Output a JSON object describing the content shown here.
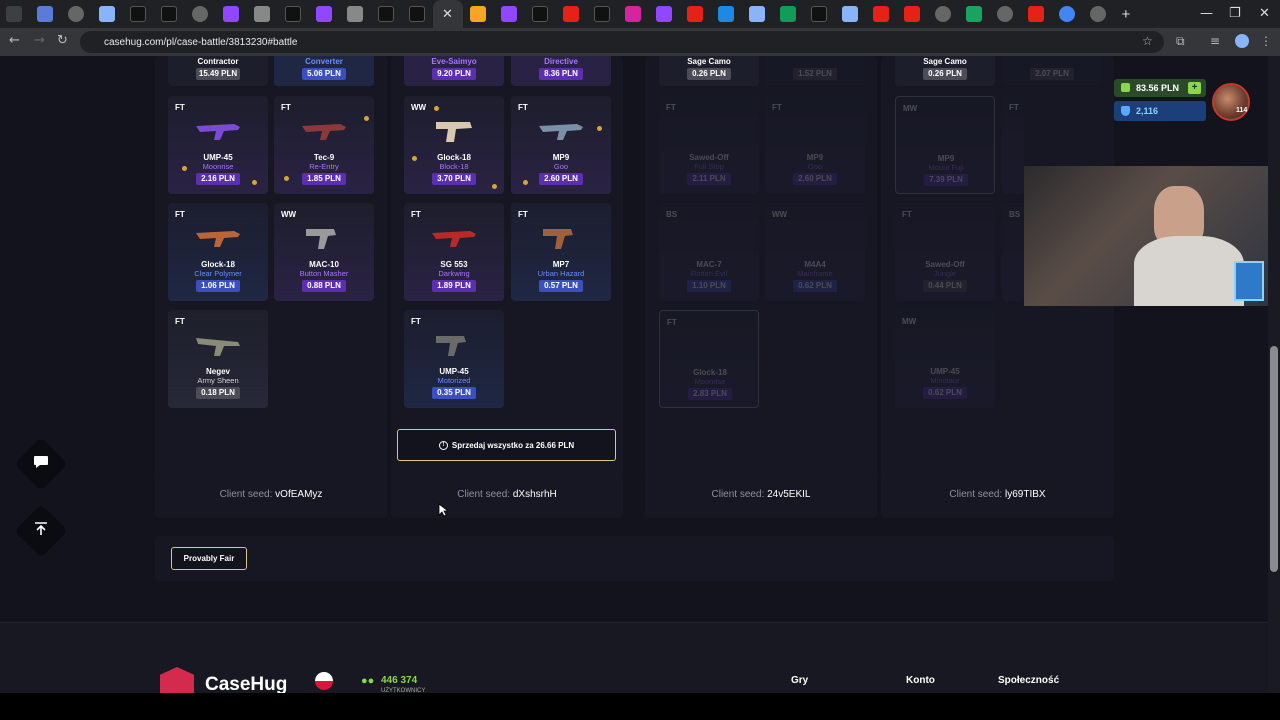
{
  "browser": {
    "url": "casehug.com/pl/case-battle/3813230#battle",
    "active_tab_close": "✕",
    "new_tab": "+",
    "minimize": "—",
    "restore": "❐",
    "close": "✕"
  },
  "nav": {
    "back_icon": "←",
    "forward_icon": "→",
    "reload_icon": "↻"
  },
  "top_row": {
    "col1": [
      {
        "name": "Contractor",
        "price": "15.49 PLN"
      },
      {
        "name": "Converter",
        "price": "5.06 PLN"
      }
    ],
    "col2": [
      {
        "name": "Eve-Saimyo",
        "price": "9.20 PLN"
      },
      {
        "name": "Directive",
        "price": "8.36 PLN"
      }
    ],
    "col3": [
      {
        "name": "Sage Camo",
        "price": "0.26 PLN"
      },
      {
        "name": "",
        "price": "1.52 PLN"
      }
    ],
    "col4": [
      {
        "name": "Sage Camo",
        "price": "0.26 PLN"
      },
      {
        "name": "",
        "price": "2.07 PLN"
      }
    ]
  },
  "columns": [
    {
      "cards": [
        {
          "wear": "FT",
          "name": "UMP-45",
          "skin": "Moonrise",
          "price": "2.16 PLN"
        },
        {
          "wear": "FT",
          "name": "Tec-9",
          "skin": "Re-Entry",
          "price": "1.85 PLN"
        },
        {
          "wear": "FT",
          "name": "Glock-18",
          "skin": "Clear Polymer",
          "price": "1.06 PLN"
        },
        {
          "wear": "WW",
          "name": "MAC-10",
          "skin": "Button Masher",
          "price": "0.88 PLN"
        },
        {
          "wear": "FT",
          "name": "Negev",
          "skin": "Army Sheen",
          "price": "0.18 PLN"
        }
      ]
    },
    {
      "cards": [
        {
          "wear": "WW",
          "name": "Glock-18",
          "skin": "Block-18",
          "price": "3.70 PLN"
        },
        {
          "wear": "FT",
          "name": "MP9",
          "skin": "Goo",
          "price": "2.60 PLN"
        },
        {
          "wear": "FT",
          "name": "SG 553",
          "skin": "Darkwing",
          "price": "1.89 PLN"
        },
        {
          "wear": "FT",
          "name": "MP7",
          "skin": "Urban Hazard",
          "price": "0.57 PLN"
        },
        {
          "wear": "FT",
          "name": "UMP-45",
          "skin": "Motorized",
          "price": "0.35 PLN"
        }
      ]
    },
    {
      "cards": [
        {
          "wear": "FT",
          "name": "Sawed-Off",
          "skin": "Full Stop",
          "price": "2.11 PLN"
        },
        {
          "wear": "FT",
          "name": "MP9",
          "skin": "Goo",
          "price": "2.60 PLN"
        },
        {
          "wear": "BS",
          "name": "MAC-7",
          "skin": "Rotten Evil",
          "price": "1.10 PLN"
        },
        {
          "wear": "WW",
          "name": "M4A4",
          "skin": "Mainframe",
          "price": "0.62 PLN"
        },
        {
          "wear": "FT",
          "name": "Glock-18",
          "skin": "Moonrise",
          "price": "2.83 PLN"
        }
      ]
    },
    {
      "cards": [
        {
          "wear": "MW",
          "name": "MP9",
          "skin": "Mount Fuji",
          "price": "7.39 PLN"
        },
        {
          "wear": "FT",
          "name": "MP9",
          "skin": "",
          "price": ""
        },
        {
          "wear": "FT",
          "name": "Sawed-Off",
          "skin": "Jungle",
          "price": "0.44 PLN"
        },
        {
          "wear": "BS",
          "name": "",
          "skin": "",
          "price": ""
        },
        {
          "wear": "MW",
          "name": "UMP-45",
          "skin": "Minotaur",
          "price": "0.62 PLN"
        }
      ]
    }
  ],
  "sell_all": "Sprzedaj wszystko za 26.66 PLN",
  "seeds": [
    {
      "label": "Client seed:",
      "value": "vOfEAMyz"
    },
    {
      "label": "Client seed:",
      "value": "dXshsrhH"
    },
    {
      "label": "Client seed:",
      "value": "24v5EKIL"
    },
    {
      "label": "Client seed:",
      "value": "ly69TIBX"
    }
  ],
  "provably_fair": "Provably Fair",
  "footer": {
    "brand": "CaseHug",
    "users_count": "446 374",
    "users_label": "UŻYTKOWNICY",
    "links": [
      "Gry",
      "Konto",
      "Społeczność"
    ]
  },
  "wallet": {
    "balance": "83.56 PLN",
    "points": "2,116",
    "level": "114"
  },
  "colors": {
    "accent_purple": "#a775ff",
    "price_purple": "#5b2fb0",
    "button_border": "#d6c77a"
  }
}
